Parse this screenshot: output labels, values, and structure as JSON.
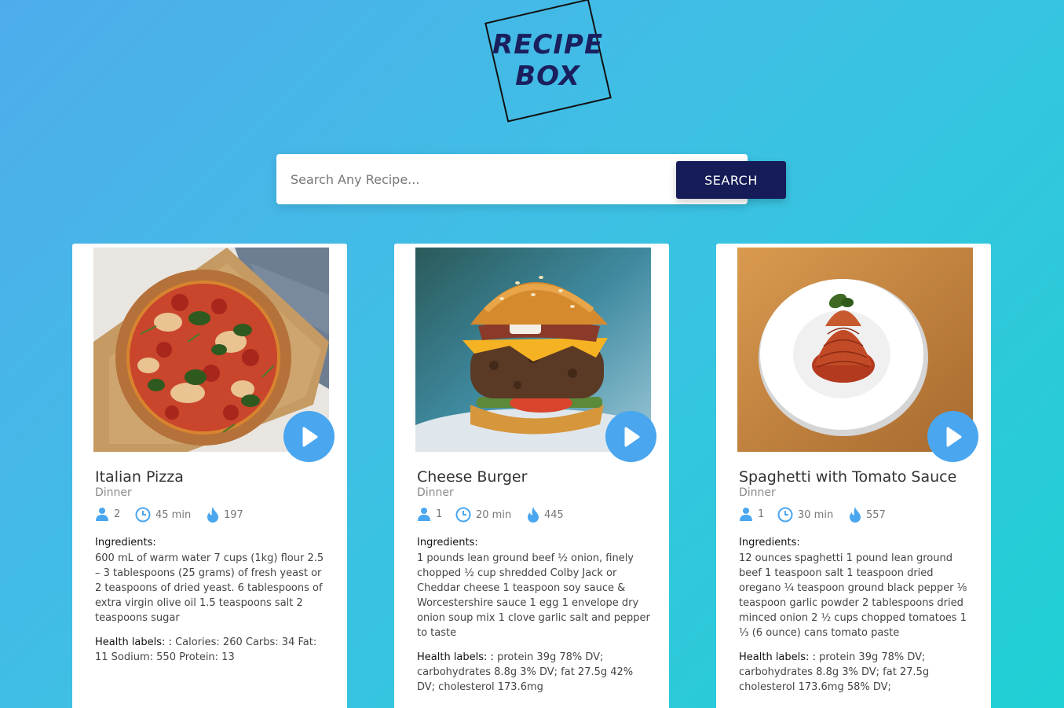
{
  "logo": {
    "line1": "RECIPE",
    "line2": "BOX"
  },
  "search": {
    "placeholder": "Search Any Recipe...",
    "value": "",
    "button_label": "SEARCH"
  },
  "colors": {
    "accent": "#4aa6ef",
    "button": "#161c57",
    "logo_text": "#1a1f5e"
  },
  "recipes": [
    {
      "title": "Italian Pizza",
      "type": "Dinner",
      "servings": "2",
      "time": "45 min",
      "calories": "197",
      "ingredients_label": "Ingredients:",
      "ingredients": "600 mL of warm water 7 cups (1kg) flour 2.5 – 3 tablespoons (25 grams) of fresh yeast or 2 teaspoons of dried yeast. 6 tablespoons of extra virgin olive oil 1.5 teaspoons salt 2 teaspoons sugar",
      "health_label": "Health labels: :",
      "health": "Calories: 260 Carbs: 34 Fat: 11 Sodium: 550 Protein: 13",
      "image": "pizza-photo"
    },
    {
      "title": "Cheese Burger",
      "type": "Dinner",
      "servings": "1",
      "time": "20 min",
      "calories": "445",
      "ingredients_label": "Ingredients:",
      "ingredients": "1 pounds lean ground beef ½ onion, finely chopped ½ cup shredded Colby Jack or Cheddar cheese 1 teaspoon soy sauce & Worcestershire sauce 1 egg 1 envelope dry onion soup mix 1 clove garlic salt and pepper to taste",
      "health_label": "Health labels: :",
      "health": "protein 39g 78% DV; carbohydrates 8.8g 3% DV; fat 27.5g 42% DV; cholesterol 173.6mg",
      "image": "burger-photo"
    },
    {
      "title": "Spaghetti with Tomato Sauce",
      "type": "Dinner",
      "servings": "1",
      "time": "30 min",
      "calories": "557",
      "ingredients_label": "Ingredients:",
      "ingredients": "12 ounces spaghetti 1 pound lean ground beef 1 teaspoon salt 1 teaspoon dried oregano ¼ teaspoon ground black pepper ⅛ teaspoon garlic powder 2 tablespoons dried minced onion 2 ½ cups chopped tomatoes 1 ⅓ (6 ounce) cans tomato paste",
      "health_label": "Health labels: :",
      "health": "protein 39g 78% DV; carbohydrates 8.8g 3% DV; fat 27.5g cholesterol 173.6mg 58% DV;",
      "image": "spaghetti-photo"
    }
  ]
}
